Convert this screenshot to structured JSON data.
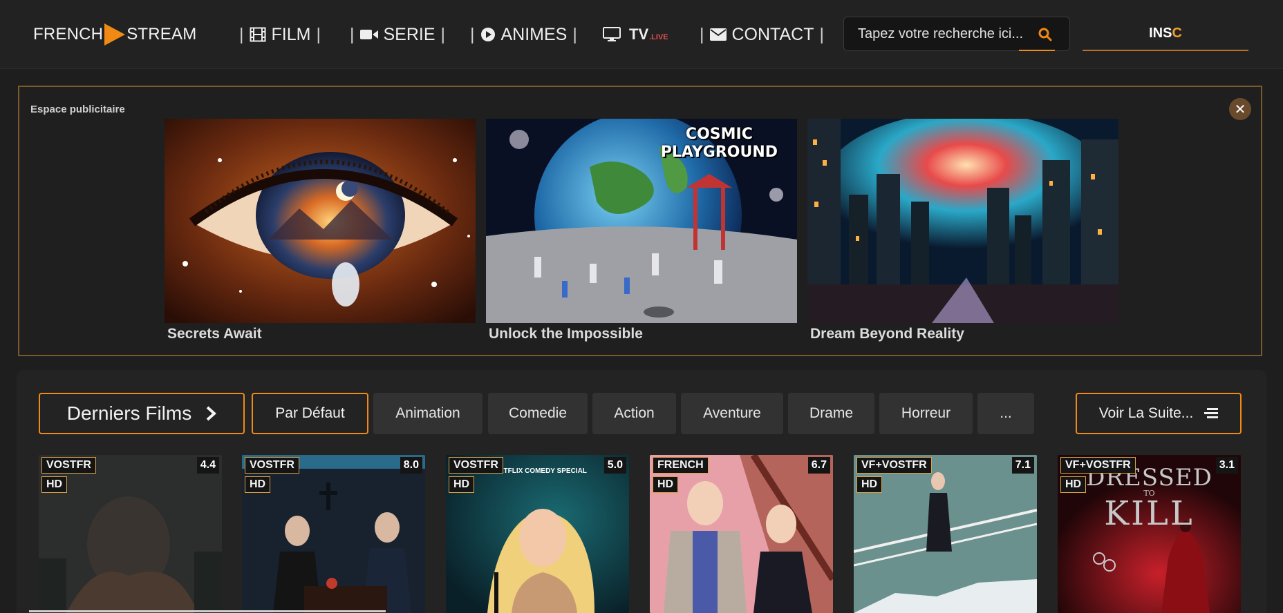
{
  "nav": {
    "logo_left": "FRENCH",
    "logo_right": "STREAM",
    "items": [
      {
        "label": "FILM",
        "icon": "film-icon"
      },
      {
        "label": "SERIE",
        "icon": "video-camera-icon"
      },
      {
        "label": "ANIMES",
        "icon": "play-circle-icon"
      },
      {
        "label": "TV",
        "suffix": ".LIVE",
        "icon": "tv-icon"
      },
      {
        "label": "CONTACT",
        "icon": "envelope-icon"
      }
    ],
    "separator": "|",
    "search_placeholder": "Tapez votre recherche ici...",
    "signup_main": "INS",
    "signup_accent": "C",
    "accent_color": "#f08a14"
  },
  "ad": {
    "label": "Espace publicitaire",
    "close": "✕",
    "cards": [
      {
        "title": "Secrets Await"
      },
      {
        "title": "Unlock the Impossible",
        "overlay_line1": "COSMIC",
        "overlay_line2": "PLAYGROUND"
      },
      {
        "title": "Dream Beyond Reality"
      }
    ]
  },
  "movies": {
    "section_title": "Derniers Films",
    "default_filter": "Par Défaut",
    "filters": [
      "Animation",
      "Comedie",
      "Action",
      "Aventure",
      "Drame",
      "Horreur",
      "..."
    ],
    "more_label": "Voir La Suite...",
    "posters": [
      {
        "lang": "VOSTFR",
        "quality": "HD",
        "rating": "4.4"
      },
      {
        "lang": "VOSTFR",
        "quality": "HD",
        "rating": "8.0"
      },
      {
        "lang": "VOSTFR",
        "quality": "HD",
        "rating": "5.0",
        "caption": "A NETFLIX COMEDY SPECIAL"
      },
      {
        "lang": "FRENCH",
        "quality": "HD",
        "rating": "6.7"
      },
      {
        "lang": "VF+VOSTFR",
        "quality": "HD",
        "rating": "7.1"
      },
      {
        "lang": "VF+VOSTFR",
        "quality": "HD",
        "rating": "3.1",
        "caption_line1": "DRESSED",
        "caption_line2": "TO",
        "caption_line3": "KILL"
      }
    ]
  }
}
